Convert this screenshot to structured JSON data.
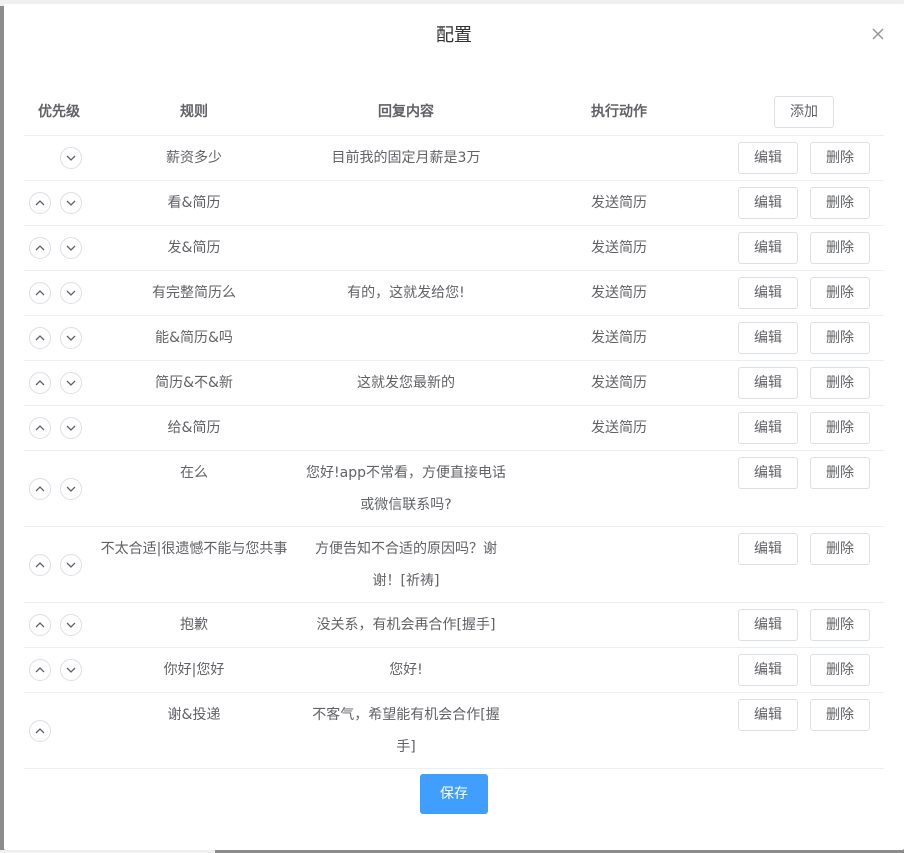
{
  "dialog": {
    "title": "配置",
    "save_label": "保存"
  },
  "table": {
    "headers": {
      "priority": "优先级",
      "rule": "规则",
      "reply": "回复内容",
      "action": "执行动作"
    },
    "add_label": "添加",
    "edit_label": "编辑",
    "delete_label": "删除",
    "rows": [
      {
        "rule": "薪资多少",
        "reply": "目前我的固定月薪是3万",
        "action": ""
      },
      {
        "rule": "看&简历",
        "reply": "",
        "action": "发送简历"
      },
      {
        "rule": "发&简历",
        "reply": "",
        "action": "发送简历"
      },
      {
        "rule": "有完整简历么",
        "reply": "有的，这就发给您!",
        "action": "发送简历"
      },
      {
        "rule": "能&简历&吗",
        "reply": "",
        "action": "发送简历"
      },
      {
        "rule": "简历&不&新",
        "reply": "这就发您最新的",
        "action": "发送简历"
      },
      {
        "rule": "给&简历",
        "reply": "",
        "action": "发送简历"
      },
      {
        "rule": "在么",
        "reply": "您好!app不常看，方便直接电话或微信联系吗?",
        "action": ""
      },
      {
        "rule": "不太合适|很遗憾不能与您共事",
        "reply": "方便告知不合适的原因吗？谢谢！[祈祷]",
        "action": ""
      },
      {
        "rule": "抱歉",
        "reply": "没关系，有机会再合作[握手]",
        "action": ""
      },
      {
        "rule": "你好|您好",
        "reply": "您好!",
        "action": ""
      },
      {
        "rule": "谢&投递",
        "reply": "不客气，希望能有机会合作[握手]",
        "action": ""
      }
    ]
  }
}
